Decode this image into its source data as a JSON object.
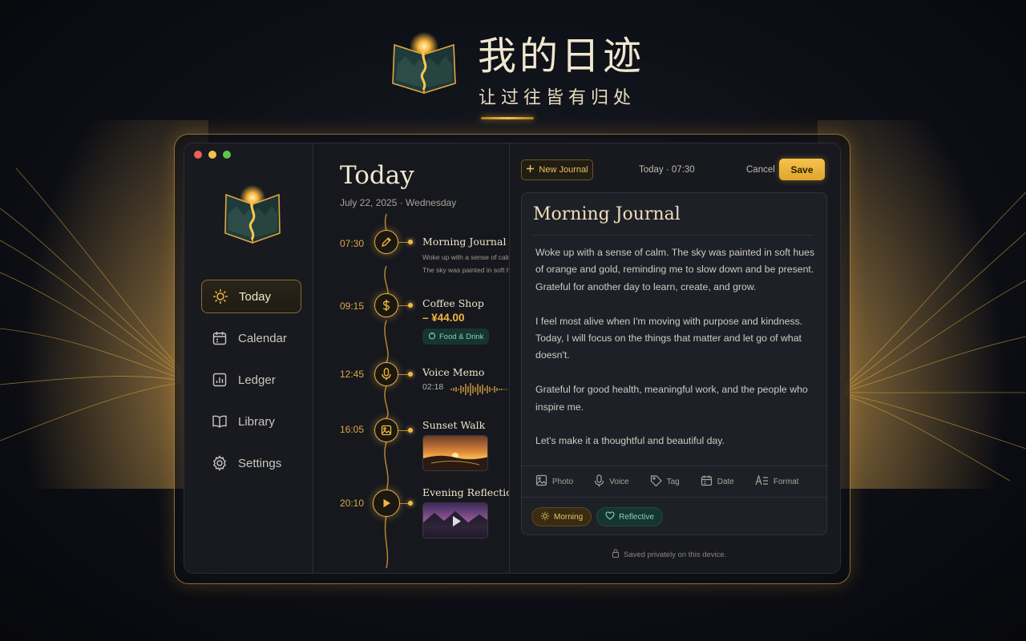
{
  "hero": {
    "title": "我的日迹",
    "subtitle": "让过往皆有归处"
  },
  "colors": {
    "accent": "#F2B542",
    "teal": "#7FD3BF",
    "traffic_red": "#ED5F57",
    "traffic_yellow": "#F5BE4F",
    "traffic_green": "#5FC453"
  },
  "sidebar": {
    "items": [
      {
        "label": "Today",
        "icon": "sun-icon",
        "active": true
      },
      {
        "label": "Calendar",
        "icon": "calendar-icon",
        "active": false
      },
      {
        "label": "Ledger",
        "icon": "bar-chart-icon",
        "active": false
      },
      {
        "label": "Library",
        "icon": "book-icon",
        "active": false
      },
      {
        "label": "Settings",
        "icon": "gear-icon",
        "active": false
      }
    ]
  },
  "timeline": {
    "title": "Today",
    "date": "July 22, 2025 · Wednesday",
    "entries": [
      {
        "time": "07:30",
        "icon": "pencil-icon",
        "title": "Morning Journal",
        "lines": [
          "Woke up with a sense of calm.",
          "The sky was painted in soft hues..."
        ]
      },
      {
        "time": "09:15",
        "icon": "dollar-icon",
        "title": "Coffee Shop",
        "amount": "– ¥44.00",
        "category": "Food & Drink"
      },
      {
        "time": "12:45",
        "icon": "microphone-icon",
        "title": "Voice Memo",
        "duration": "02:18"
      },
      {
        "time": "16:05",
        "icon": "image-icon",
        "title": "Sunset Walk"
      },
      {
        "time": "20:10",
        "icon": "play-icon",
        "title": "Evening Reflection"
      }
    ]
  },
  "editor": {
    "new_journal_label": "New Journal",
    "date_label": "Today · 07:30",
    "cancel_label": "Cancel",
    "save_label": "Save",
    "title": "Morning Journal",
    "paragraphs": [
      "Woke up with a sense of calm. The sky was painted in soft hues of orange and gold, reminding me to slow down and be present. Grateful for another day to learn, create, and grow.",
      "I feel most alive when I'm moving with purpose and kindness. Today, I will focus on the things that matter and let go of what doesn't.",
      "Grateful for good health, meaningful work, and the people who inspire me.",
      "Let's make it a thoughtful and beautiful day."
    ],
    "toolbar": [
      {
        "label": "Photo",
        "icon": "image-icon"
      },
      {
        "label": "Voice",
        "icon": "microphone-icon"
      },
      {
        "label": "Tag",
        "icon": "tag-icon"
      },
      {
        "label": "Date",
        "icon": "calendar-icon"
      },
      {
        "label": "Format",
        "icon": "text-format-icon"
      }
    ],
    "tags": [
      {
        "label": "Morning",
        "icon": "sun-icon"
      },
      {
        "label": "Reflective",
        "icon": "heart-icon"
      }
    ],
    "footer_note": "Saved privately on this device."
  }
}
